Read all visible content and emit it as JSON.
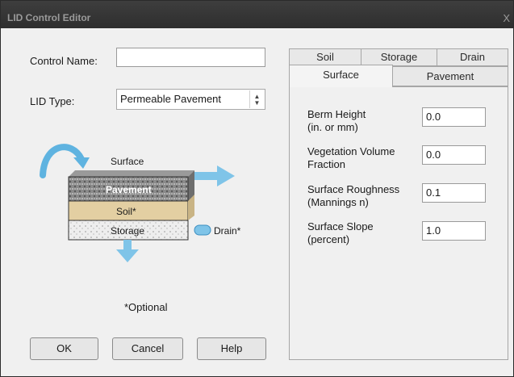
{
  "window": {
    "title": "LID Control Editor",
    "close_glyph": "X"
  },
  "form": {
    "control_name_label": "Control Name:",
    "control_name_value": "",
    "lid_type_label": "LID Type:",
    "lid_type_value": "Permeable Pavement"
  },
  "diagram": {
    "surface": "Surface",
    "pavement": "Pavement",
    "soil": "Soil*",
    "storage": "Storage",
    "drain": "Drain*",
    "optional_note": "*Optional"
  },
  "buttons": {
    "ok": "OK",
    "cancel": "Cancel",
    "help": "Help"
  },
  "tabs": {
    "row_back": [
      "Soil",
      "Storage",
      "Drain"
    ],
    "row_front": [
      "Surface",
      "Pavement"
    ],
    "active": "Surface"
  },
  "surface_params": [
    {
      "label_line1": "Berm Height",
      "label_line2": "(in. or mm)",
      "value": "0.0"
    },
    {
      "label_line1": "Vegetation Volume",
      "label_line2": "Fraction",
      "value": "0.0"
    },
    {
      "label_line1": "Surface Roughness",
      "label_line2": "(Mannings n)",
      "value": "0.1"
    },
    {
      "label_line1": "Surface Slope",
      "label_line2": "(percent)",
      "value": "1.0"
    }
  ],
  "colors": {
    "pavement": "#7d7d7d",
    "soil": "#e3cfa2",
    "storage": "#ececec",
    "water": "#7fc4e8"
  }
}
